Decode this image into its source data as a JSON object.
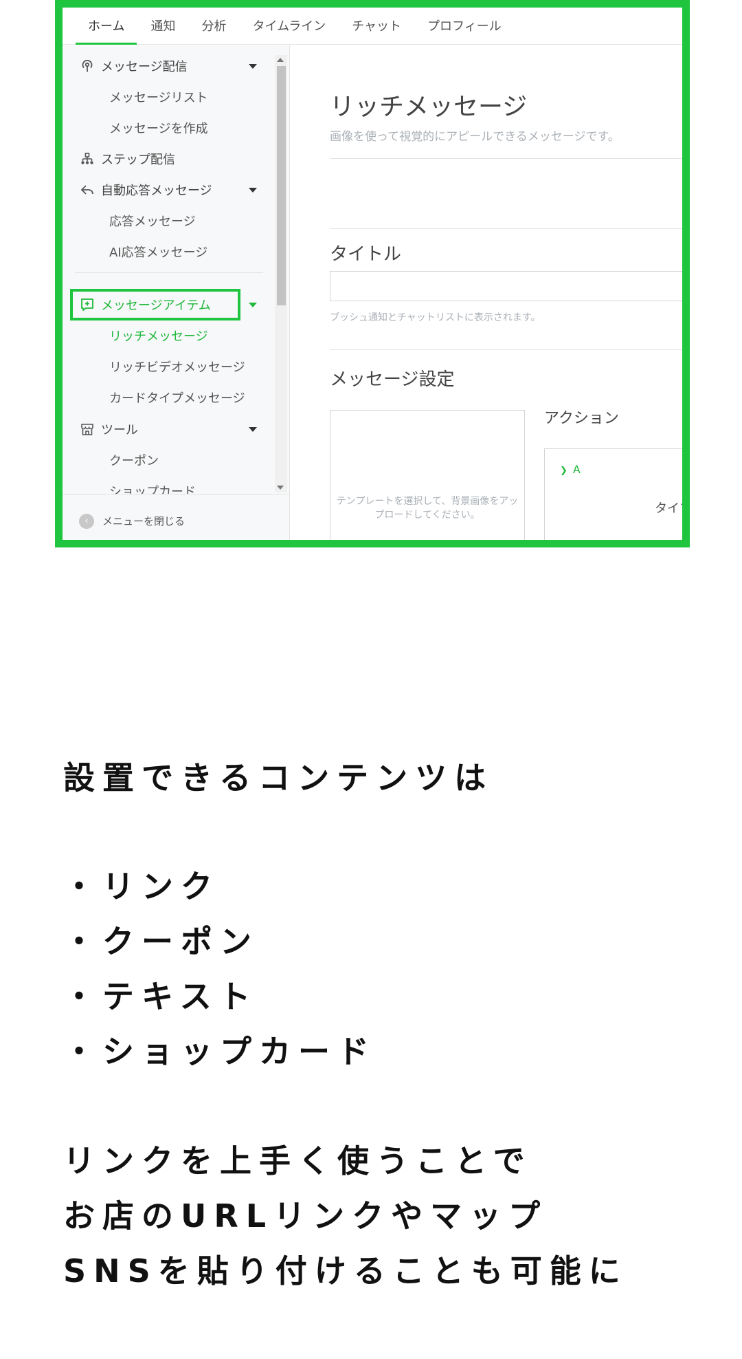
{
  "top_nav": {
    "tabs": [
      {
        "label": "ホーム",
        "active": true
      },
      {
        "label": "通知"
      },
      {
        "label": "分析"
      },
      {
        "label": "タイムライン"
      },
      {
        "label": "チャット"
      },
      {
        "label": "プロフィール"
      }
    ]
  },
  "sidebar": {
    "message_delivery": {
      "label": "メッセージ配信",
      "icon": "broadcast-icon"
    },
    "message_list": "メッセージリスト",
    "create_message": "メッセージを作成",
    "step_delivery": {
      "label": "ステップ配信",
      "icon": "hierarchy-icon"
    },
    "auto_reply": {
      "label": "自動応答メッセージ",
      "icon": "reply-icon"
    },
    "reply_message": "応答メッセージ",
    "ai_reply_message": "AI応答メッセージ",
    "message_items": {
      "label": "メッセージアイテム",
      "icon": "add-message-icon"
    },
    "rich_message": "リッチメッセージ",
    "rich_video_message": "リッチビデオメッセージ",
    "card_type_message": "カードタイプメッセージ",
    "tools": {
      "label": "ツール",
      "icon": "shop-icon"
    },
    "coupon": "クーポン",
    "shop_card": "ショップカード",
    "close_menu": "メニューを閉じる"
  },
  "main": {
    "title": "リッチメッセージ",
    "subtitle": "画像を使って視覚的にアピールできるメッセージです。",
    "title_section": "タイトル",
    "title_hint": "プッシュ通知とチャットリストに表示されます。",
    "message_settings": "メッセージ設定",
    "template_placeholder_line1": "テンプレートを選択して、背景画像をアッ",
    "template_placeholder_line2": "プロードしてください。",
    "action_label": "アクション",
    "action_a": "A",
    "action_type": "タイプ"
  },
  "caption": {
    "heading": "設置できるコンテンツは",
    "items": [
      "・リンク",
      "・クーポン",
      "・テキスト",
      "・ショップカード"
    ],
    "line1": "リンクを上手く使うことで",
    "line2": "お店のURLリンクやマップ",
    "line3": "SNSを貼り付けることも可能に"
  },
  "colors": {
    "accent": "#1fc43f",
    "accent_text": "#1fb83c"
  }
}
